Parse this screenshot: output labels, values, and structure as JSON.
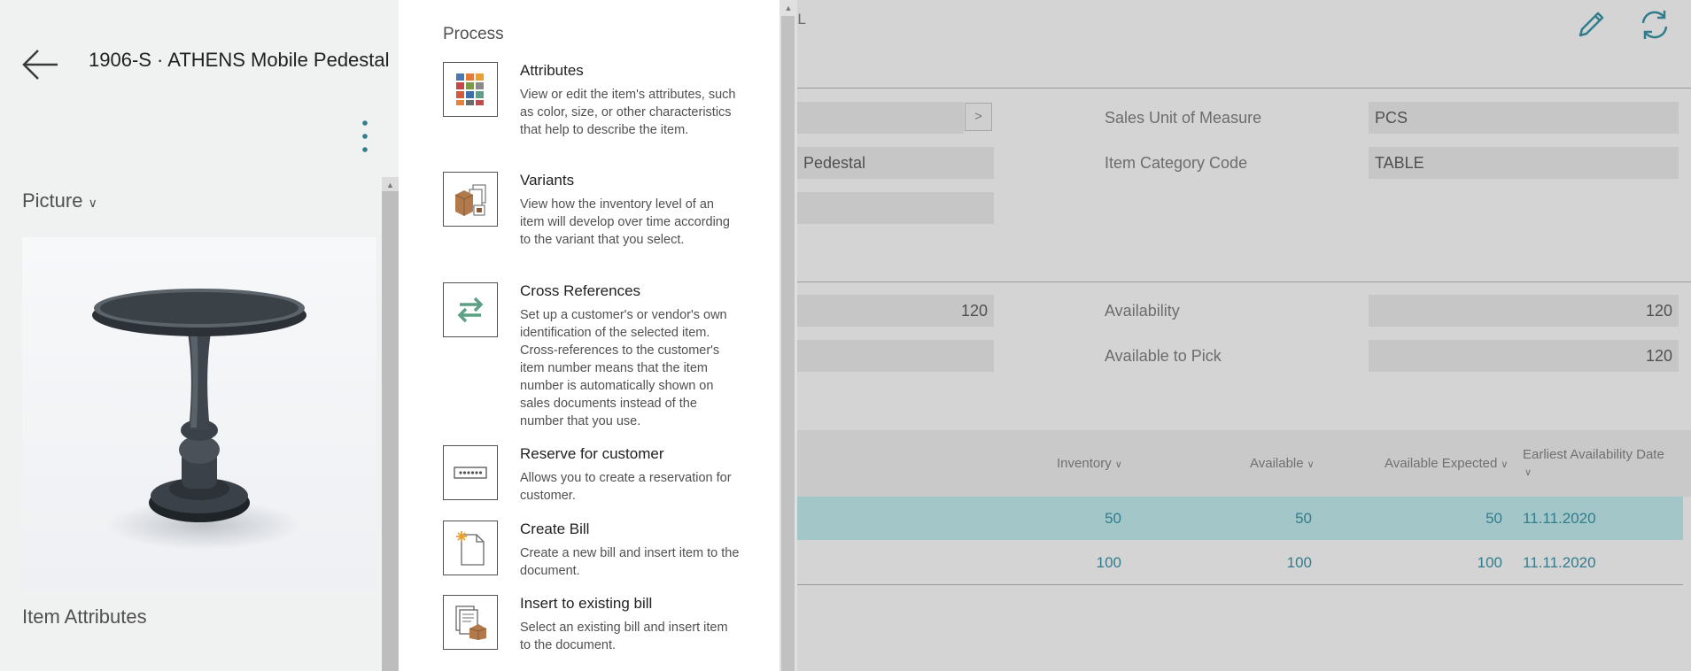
{
  "header": {
    "title": "1906-S · ATHENS Mobile Pedestal",
    "partial_header_text": "AL"
  },
  "left_panel": {
    "picture_label": "Picture",
    "item_attributes_label": "Item Attributes"
  },
  "process_menu": {
    "title": "Process",
    "items": [
      {
        "label": "Attributes",
        "description": "View or edit the item's attributes, such as color, size, or other characteristics that help to describe the item.",
        "icon": "attributes-icon"
      },
      {
        "label": "Variants",
        "description": "View how the inventory level of an item will develop over time according to the variant that you select.",
        "icon": "variants-icon"
      },
      {
        "label": "Cross References",
        "description": "Set up a customer's or vendor's own identification of the selected item. Cross-references to the customer's item number means that the item number is automatically shown on sales documents instead of the number that you use.",
        "icon": "cross-references-icon"
      },
      {
        "label": "Reserve for customer",
        "description": "Allows you to create a reservation for customer.",
        "icon": "reserve-icon"
      },
      {
        "label": "Create Bill",
        "description": "Create a new bill and insert item to the document.",
        "icon": "create-bill-icon"
      },
      {
        "label": "Insert to existing bill",
        "description": "Select an existing bill and insert item to the document.",
        "icon": "insert-bill-icon"
      }
    ]
  },
  "fields": {
    "partial_description_value": "Pedestal",
    "lookup_button_label": ">",
    "sales_unit_label": "Sales Unit of Measure",
    "sales_unit_value": "PCS",
    "item_category_label": "Item Category Code",
    "item_category_value": "TABLE",
    "partial_inventory_value": "120",
    "availability_label": "Availability",
    "availability_value": "120",
    "available_to_pick_label": "Available to Pick",
    "available_to_pick_value": "120"
  },
  "table": {
    "columns": [
      "Inventory",
      "Available",
      "Available Expected",
      "Earliest Availability Date"
    ],
    "rows": [
      {
        "inventory": "50",
        "available": "50",
        "available_expected": "50",
        "date": "11.11.2020"
      },
      {
        "inventory": "100",
        "available": "100",
        "available_expected": "100",
        "date": "11.11.2020"
      }
    ]
  },
  "colors": {
    "accent": "#317d8d",
    "selected_row": "#a3c6c8"
  }
}
